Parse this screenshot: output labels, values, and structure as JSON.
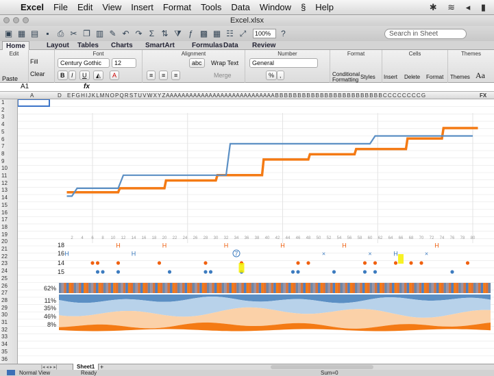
{
  "menubar": {
    "app": "Excel",
    "items": [
      "File",
      "Edit",
      "View",
      "Insert",
      "Format",
      "Tools",
      "Data",
      "Window",
      "Help"
    ],
    "script_icon": "script-icon"
  },
  "window": {
    "title": "Excel.xlsx"
  },
  "toolbar": {
    "zoom": "100%",
    "search_placeholder": "Search in Sheet"
  },
  "tabs": [
    "Home",
    "Layout",
    "Tables",
    "Charts",
    "SmartArt",
    "Formulas",
    "Data",
    "Review"
  ],
  "ribbon": {
    "groups": {
      "edit": "Edit",
      "font": "Font",
      "alignment": "Alignment",
      "number": "Number",
      "format": "Format",
      "cells": "Cells",
      "themes": "Themes"
    },
    "paste": "Paste",
    "fill": "Fill",
    "clear": "Clear",
    "font_name": "Century Gothic",
    "font_size": "12",
    "bold": "B",
    "italic": "I",
    "underline": "U",
    "text_color": "A",
    "wrap_text": "Wrap Text",
    "merge": "Merge",
    "abc": "abc",
    "number_format": "General",
    "percent": "%",
    "comma": ",",
    "conditional_formatting": "Conditional Formatting",
    "styles": "Styles",
    "insert": "Insert",
    "delete": "Delete",
    "format": "Format",
    "themes": "Themes",
    "aa": "Aa"
  },
  "formula": {
    "cell_ref": "A1",
    "fx": "fx"
  },
  "columns": {
    "a": "A",
    "d": "D",
    "rest": "E F G H I J K L M N O P Q R S T U V W X Y Z A A A A A A A A A A A A A A A A A A A A A A A A A A A A B B B B B B B B B B B B B B B B B B B B B B B B C C C C C C C C G",
    "fx": "FX"
  },
  "rows": [
    "1",
    "2",
    "3",
    "4",
    "5",
    "6",
    "7",
    "8",
    "9",
    "10",
    "11",
    "12",
    "13",
    "14",
    "15",
    "16",
    "17",
    "18",
    "19",
    "20",
    "21",
    "22",
    "23",
    "24",
    "25",
    "26",
    "27",
    "28",
    "29",
    "30",
    "31",
    "32",
    "33",
    "34",
    "35",
    "36"
  ],
  "chart_data": [
    {
      "type": "line",
      "x_ticks": [
        2,
        4,
        6,
        8,
        10,
        12,
        14,
        16,
        18,
        20,
        22,
        24,
        26,
        28,
        30,
        32,
        34,
        36,
        38,
        40,
        42,
        44,
        46,
        48,
        50,
        52,
        54,
        56,
        58,
        60,
        62,
        64,
        66,
        68,
        70,
        72,
        74,
        76,
        78,
        80
      ],
      "series": [
        {
          "color": "#f47a14",
          "x": [
            1,
            11,
            11.3,
            20,
            20.3,
            30,
            30.3,
            39,
            39.3,
            48,
            48.3,
            57,
            57.3,
            67,
            67.3,
            74,
            74.3,
            81
          ],
          "y": [
            9.5,
            9.5,
            11,
            11,
            14,
            14,
            16,
            16,
            22,
            22,
            24,
            24,
            26,
            26,
            30,
            30,
            34,
            34
          ]
        },
        {
          "color": "#5b8fc4",
          "x": [
            1,
            2,
            3,
            11,
            12,
            13,
            32,
            32.8,
            60,
            61,
            80
          ],
          "y": [
            8,
            8,
            11,
            11,
            16,
            16,
            16,
            28,
            28,
            31,
            31
          ]
        }
      ]
    },
    {
      "type": "scatter",
      "rows": [
        {
          "label": "18",
          "points": [
            {
              "x": 11,
              "m": "H"
            },
            {
              "x": 20,
              "m": "H"
            },
            {
              "x": 32,
              "m": "H"
            },
            {
              "x": 43,
              "m": "H"
            },
            {
              "x": 55,
              "m": "H"
            },
            {
              "x": 73,
              "m": "H"
            }
          ]
        },
        {
          "label": "16",
          "points": [
            {
              "x": 1,
              "m": "H"
            },
            {
              "x": 14,
              "m": "H"
            },
            {
              "x": 34,
              "m": "7"
            },
            {
              "x": 51,
              "m": "×"
            },
            {
              "x": 60,
              "m": "×"
            },
            {
              "x": 65,
              "m": "H"
            },
            {
              "x": 71,
              "m": "×"
            }
          ]
        },
        {
          "label": "14",
          "points": [
            {
              "x": 6,
              "m": "●"
            },
            {
              "x": 7,
              "m": "●"
            },
            {
              "x": 11,
              "m": "●"
            },
            {
              "x": 19,
              "m": "●"
            },
            {
              "x": 28,
              "m": "●"
            },
            {
              "x": 35,
              "m": "●"
            },
            {
              "x": 46,
              "m": "●"
            },
            {
              "x": 48,
              "m": "●"
            },
            {
              "x": 59,
              "m": "●"
            },
            {
              "x": 61,
              "m": "●"
            },
            {
              "x": 65,
              "m": "●"
            },
            {
              "x": 68,
              "m": "●"
            },
            {
              "x": 70,
              "m": "●"
            },
            {
              "x": 79,
              "m": "●"
            }
          ]
        },
        {
          "label": "15",
          "points": [
            {
              "x": 7,
              "m": "●"
            },
            {
              "x": 8,
              "m": "●"
            },
            {
              "x": 11,
              "m": "●"
            },
            {
              "x": 21,
              "m": "●"
            },
            {
              "x": 28,
              "m": "●"
            },
            {
              "x": 29,
              "m": "●"
            },
            {
              "x": 35,
              "m": "●"
            },
            {
              "x": 45,
              "m": "●"
            },
            {
              "x": 46,
              "m": "●"
            },
            {
              "x": 53,
              "m": "●"
            },
            {
              "x": 59,
              "m": "●"
            },
            {
              "x": 61,
              "m": "●"
            },
            {
              "x": 76,
              "m": "●"
            }
          ]
        }
      ]
    },
    {
      "type": "heatmap",
      "label": "62%"
    },
    {
      "type": "area",
      "labels": [
        "11%",
        "35%",
        "46%",
        "8%"
      ],
      "colors": [
        "#5b8fc4",
        "#b8d2ea",
        "#fbd1a8",
        "#f47a14"
      ]
    }
  ],
  "sheet": {
    "tab": "Sheet1"
  },
  "status": {
    "view": "Normal View",
    "ready": "Ready",
    "sum": "Sum=0"
  }
}
